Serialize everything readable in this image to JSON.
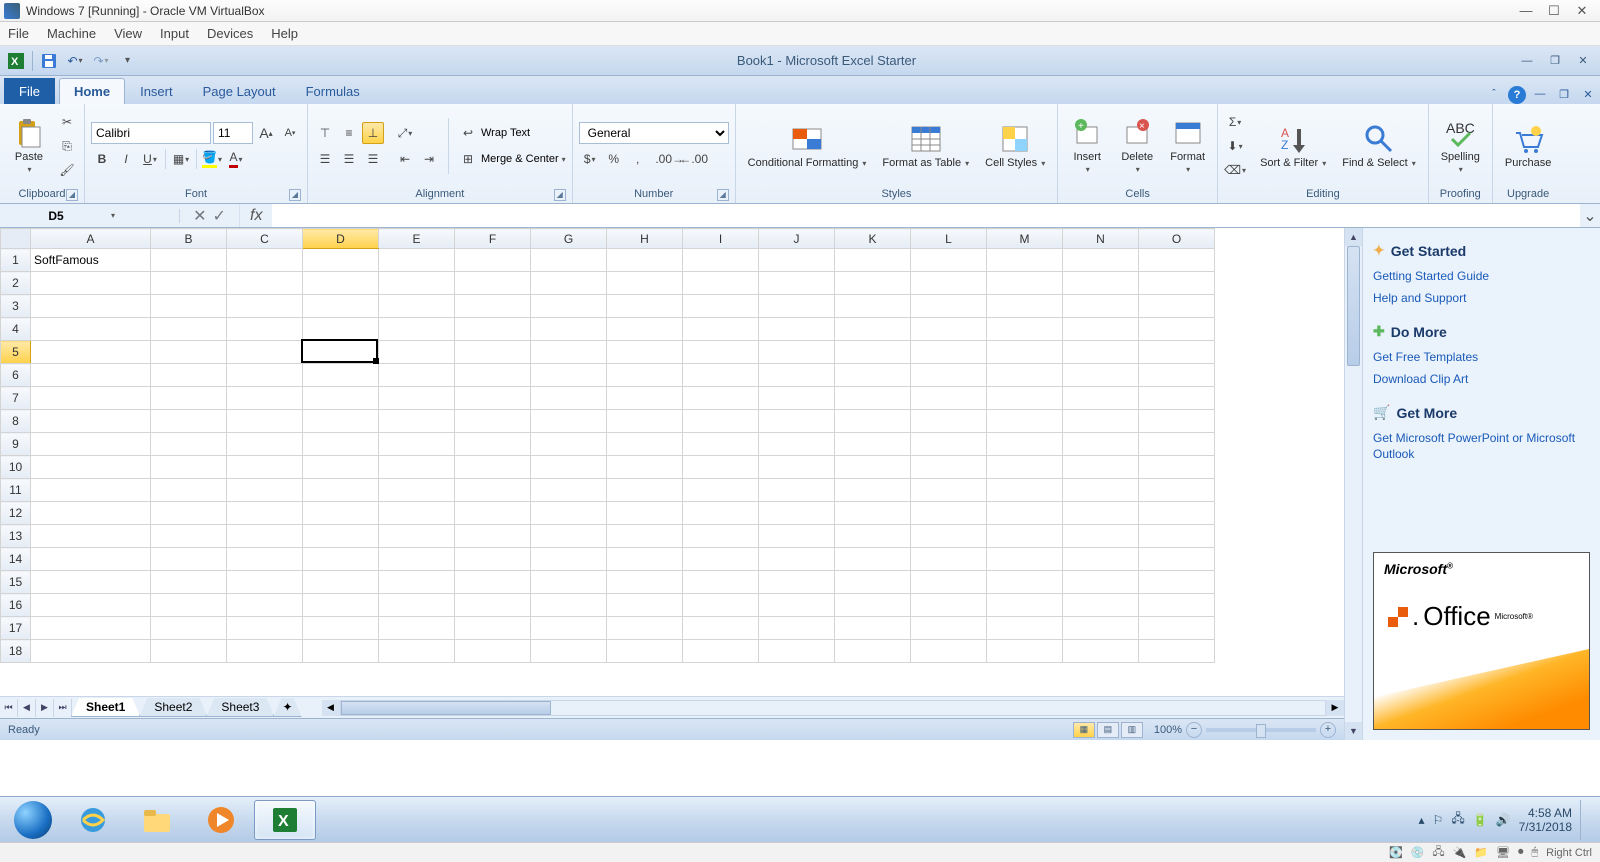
{
  "vb": {
    "title": "Windows 7 [Running] - Oracle VM VirtualBox",
    "menus": [
      "File",
      "Machine",
      "View",
      "Input",
      "Devices",
      "Help"
    ],
    "status_label": "Right Ctrl"
  },
  "excel": {
    "title": "Book1  -  Microsoft Excel Starter",
    "file_tab": "File",
    "tabs": [
      "Home",
      "Insert",
      "Page Layout",
      "Formulas"
    ],
    "active_tab": "Home",
    "ribbon": {
      "clipboard": {
        "label": "Clipboard",
        "paste": "Paste"
      },
      "font": {
        "label": "Font",
        "name": "Calibri",
        "size": "11"
      },
      "alignment": {
        "label": "Alignment",
        "wrap": "Wrap Text",
        "merge": "Merge & Center"
      },
      "number": {
        "label": "Number",
        "format": "General"
      },
      "styles": {
        "label": "Styles",
        "cond": "Conditional Formatting",
        "table": "Format as Table",
        "cell": "Cell Styles"
      },
      "cells": {
        "label": "Cells",
        "insert": "Insert",
        "delete": "Delete",
        "format": "Format"
      },
      "editing": {
        "label": "Editing",
        "sort": "Sort & Filter",
        "find": "Find & Select"
      },
      "proofing": {
        "label": "Proofing",
        "spell": "Spelling"
      },
      "upgrade": {
        "label": "Upgrade",
        "purchase": "Purchase"
      }
    },
    "namebox": "D5",
    "formula": "",
    "columns": [
      "A",
      "B",
      "C",
      "D",
      "E",
      "F",
      "G",
      "H",
      "I",
      "J",
      "K",
      "L",
      "M",
      "N",
      "O"
    ],
    "rows": [
      1,
      2,
      3,
      4,
      5,
      6,
      7,
      8,
      9,
      10,
      11,
      12,
      13,
      14,
      15,
      16,
      17,
      18
    ],
    "selected_col": "D",
    "selected_row": 5,
    "cells": {
      "A1": "SoftFamous"
    },
    "sheets": [
      "Sheet1",
      "Sheet2",
      "Sheet3"
    ],
    "active_sheet": "Sheet1",
    "status": "Ready",
    "zoom": "100%"
  },
  "side": {
    "h1": "Get Started",
    "l1": "Getting Started Guide",
    "l2": "Help and Support",
    "h2": "Do More",
    "l3": "Get Free Templates",
    "l4": "Download Clip Art",
    "h3": "Get More",
    "l5": "Get Microsoft PowerPoint or Microsoft Outlook",
    "ms": "Microsoft",
    "office": "Office"
  },
  "taskbar": {
    "time": "4:58 AM",
    "date": "7/31/2018"
  }
}
